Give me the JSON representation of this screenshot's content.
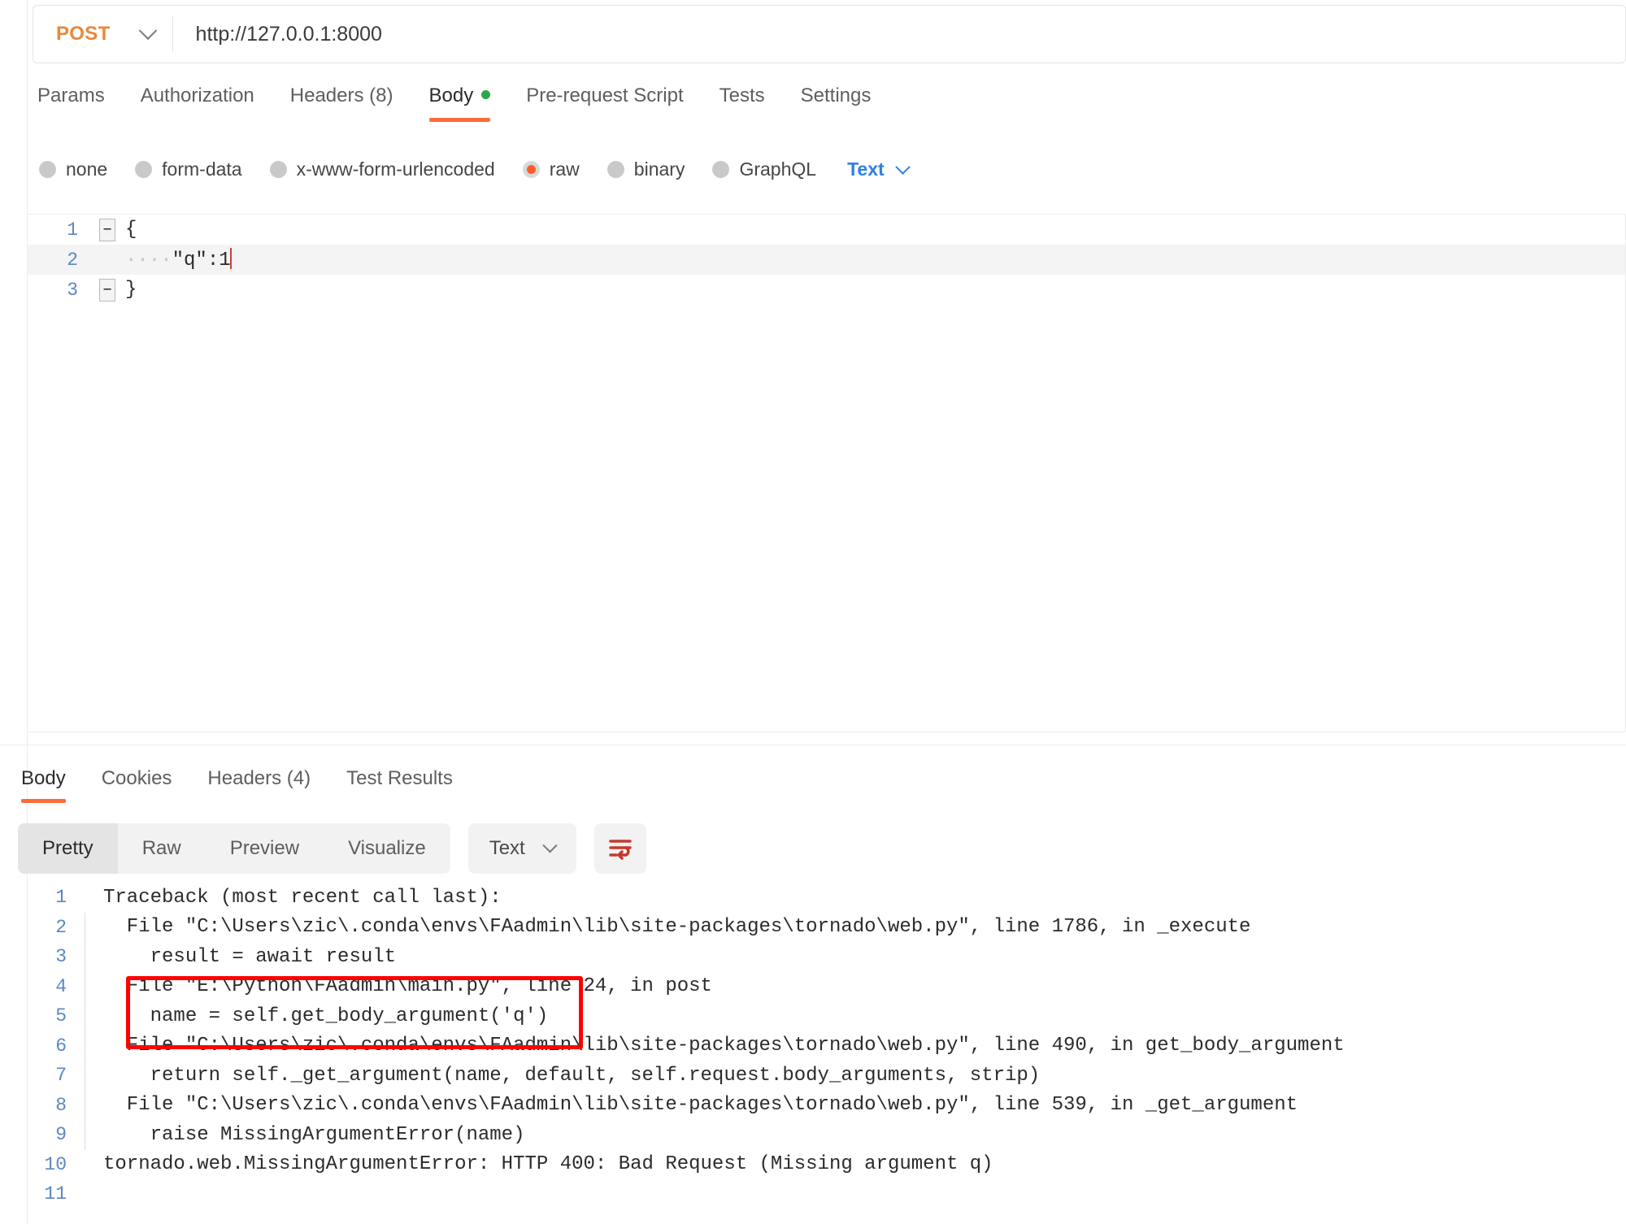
{
  "request": {
    "method": "POST",
    "method_icon": "chevron-down-icon",
    "url": "http://127.0.0.1:8000",
    "url_placeholder": "Enter request URL",
    "tabs": [
      {
        "label": "Params",
        "active": false,
        "dot": false
      },
      {
        "label": "Authorization",
        "active": false,
        "dot": false
      },
      {
        "label": "Headers (8)",
        "active": false,
        "dot": false
      },
      {
        "label": "Body",
        "active": true,
        "dot": true
      },
      {
        "label": "Pre-request Script",
        "active": false,
        "dot": false
      },
      {
        "label": "Tests",
        "active": false,
        "dot": false
      },
      {
        "label": "Settings",
        "active": false,
        "dot": false
      }
    ],
    "body_types": [
      {
        "label": "none",
        "checked": false
      },
      {
        "label": "form-data",
        "checked": false
      },
      {
        "label": "x-www-form-urlencoded",
        "checked": false
      },
      {
        "label": "raw",
        "checked": true
      },
      {
        "label": "binary",
        "checked": false
      },
      {
        "label": "GraphQL",
        "checked": false
      }
    ],
    "raw_format": {
      "label": "Text",
      "icon": "chevron-down-icon",
      "color": "#2f7fe8"
    },
    "editor": {
      "lines": [
        {
          "num": "1",
          "fold": "−",
          "text": "{",
          "highlighted": false
        },
        {
          "num": "2",
          "fold": "",
          "dots": "····",
          "text": "\"q\":1",
          "highlighted": true
        },
        {
          "num": "3",
          "fold": "−",
          "text": "}",
          "highlighted": false
        }
      ]
    }
  },
  "response": {
    "tabs": [
      {
        "label": "Body",
        "active": true
      },
      {
        "label": "Cookies",
        "active": false
      },
      {
        "label": "Headers (4)",
        "active": false
      },
      {
        "label": "Test Results",
        "active": false
      }
    ],
    "view_modes": [
      {
        "label": "Pretty",
        "active": true
      },
      {
        "label": "Raw",
        "active": false
      },
      {
        "label": "Preview",
        "active": false
      },
      {
        "label": "Visualize",
        "active": false
      }
    ],
    "format": {
      "label": "Text",
      "icon": "chevron-down-icon"
    },
    "wrap_button": {
      "icon": "word-wrap-icon",
      "color": "#c4392c"
    },
    "body_lines": [
      {
        "num": "1",
        "bar": false,
        "text": "Traceback (most recent call last):"
      },
      {
        "num": "2",
        "bar": true,
        "text": "  File \"C:\\Users\\zic\\.conda\\envs\\FAadmin\\lib\\site-packages\\tornado\\web.py\", line 1786, in _execute"
      },
      {
        "num": "3",
        "bar": true,
        "text": "    result = await result"
      },
      {
        "num": "4",
        "bar": true,
        "text": "  File \"E:\\Python\\FAadmin\\main.py\", line 24, in post"
      },
      {
        "num": "5",
        "bar": true,
        "text": "    name = self.get_body_argument('q')"
      },
      {
        "num": "6",
        "bar": true,
        "text": "  File \"C:\\Users\\zic\\.conda\\envs\\FAadmin\\lib\\site-packages\\tornado\\web.py\", line 490, in get_body_argument"
      },
      {
        "num": "7",
        "bar": true,
        "text": "    return self._get_argument(name, default, self.request.body_arguments, strip)"
      },
      {
        "num": "8",
        "bar": true,
        "text": "  File \"C:\\Users\\zic\\.conda\\envs\\FAadmin\\lib\\site-packages\\tornado\\web.py\", line 539, in _get_argument"
      },
      {
        "num": "9",
        "bar": true,
        "text": "    raise MissingArgumentError(name)"
      },
      {
        "num": "10",
        "bar": false,
        "text": "tornado.web.MissingArgumentError: HTTP 400: Bad Request (Missing argument q)"
      },
      {
        "num": "11",
        "bar": false,
        "text": ""
      }
    ]
  },
  "annotation": {
    "shape": "rectangle",
    "color": "#ff0000"
  }
}
